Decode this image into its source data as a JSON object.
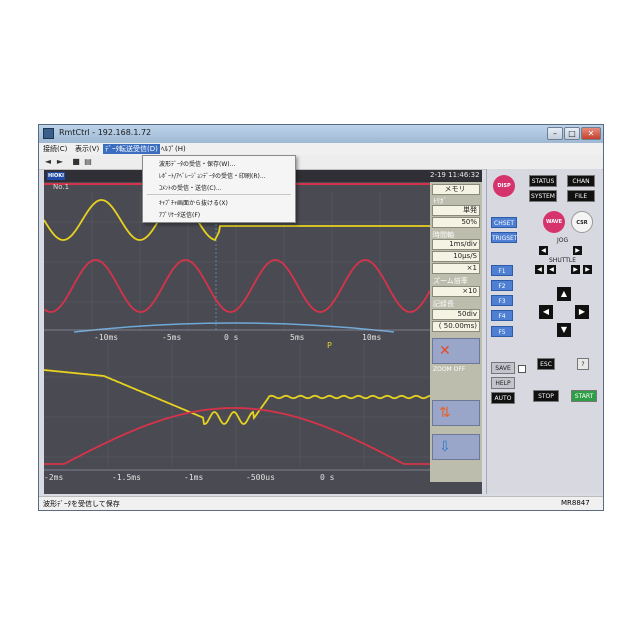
{
  "window": {
    "title": "RmtCtrl - 192.168.1.72",
    "min": "–",
    "max": "□",
    "close": "✕"
  },
  "menu": {
    "items": [
      {
        "label": "接続(C)"
      },
      {
        "label": "表示(V)"
      },
      {
        "label": "ﾃﾞｰﾀ転送受信(D)"
      },
      {
        "label": "ﾍﾙﾌﾟ(H)"
      }
    ],
    "selected_index": 2,
    "dropdown": [
      {
        "label": "波形ﾃﾞｰﾀの受信・保存(W)..."
      },
      {
        "label": "ﾚﾎﾟｰﾄ/ｱﾍﾞﾚｰｼﾞｮﾝﾃﾞｰﾀの受信・印刷(R)..."
      },
      {
        "label": "ｺﾒﾝﾄの受信・送信(C)..."
      },
      {
        "label": "ｷｬﾌﾟﾁｬ画面から抜ける(X)"
      },
      {
        "label": "ｱﾌﾟﾘｹｰﾀ送信(F)"
      }
    ]
  },
  "toolbar": {
    "icons": [
      "arrow-left-icon",
      "arrow-right-icon",
      "save-icon",
      "print-icon"
    ]
  },
  "scope": {
    "logo": "HIOKI",
    "time": "2-19 11:46:32",
    "channel_label": "No.1",
    "upper_axis_ticks": [
      "-10ms",
      "-5ms",
      "0 s",
      "5ms",
      "10ms"
    ],
    "lower_axis_ticks": [
      "-2ms",
      "-1.5ms",
      "-1ms",
      "-500us",
      "0 s"
    ],
    "trigger_marker": "P",
    "side": {
      "mode": "メモリ",
      "trigger_label": "ﾄﾘｶﾞ",
      "trigger_value": "単発",
      "pretrig_value": "50%",
      "timebase_label": "時間軸",
      "timebase_value": "1ms/div",
      "sampling_value": "10μs/S",
      "zoom_x": "×1",
      "zoom_label": "ズーム倍率",
      "zoom_value": "×10",
      "record_label": "記録長",
      "record_value": "50div",
      "record_time": "( 50.00ms)",
      "zoom_off": "ZOOM OFF"
    }
  },
  "panel": {
    "disp": "DISP",
    "status": "STATUS",
    "chan": "CHAN",
    "system": "SYSTEM",
    "file": "FILE",
    "chset": "CHSET",
    "trigset": "TRIGSET",
    "wave": "WAVE",
    "csr": "CSR",
    "jog": "JOG",
    "shuttle": "SHUTTLE",
    "f_keys": [
      "F1",
      "F2",
      "F3",
      "F4",
      "F5"
    ],
    "save": "SAVE",
    "help": "HELP",
    "esc": "ESC",
    "auto": "AUTO",
    "stop": "STOP",
    "start": "START",
    "model": "MR8847"
  },
  "status_text": "波形ﾃﾞｰﾀを受信して保存",
  "colors": {
    "yellow": "#e7d21f",
    "red": "#d6334a",
    "blue": "#6fa9d8",
    "disp": "#d6336c",
    "start": "#2f9e47"
  }
}
